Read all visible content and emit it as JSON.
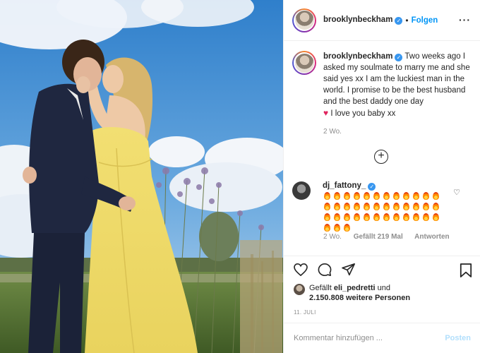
{
  "post": {
    "username": "brooklynbeckham",
    "follow_label": "Folgen",
    "more_icon": "ellipsis-icon",
    "caption": "Two weeks ago I asked my soulmate to marry me and she said yes xx I am the luckiest man in the world. I promise to be the best husband and the best daddy one day",
    "caption_tail": "I love you baby xx",
    "caption_time": "2 Wo.",
    "load_more_icon": "plus-circle-icon"
  },
  "comment": {
    "username": "dj_fattony_",
    "emoji_name": "fire-emoji",
    "emoji_count": 39,
    "time": "2 Wo.",
    "likes": "Gefällt 219 Mal",
    "reply_label": "Antworten"
  },
  "actions": {
    "liked_prefix": "Gefällt",
    "liked_user": "eli_pedretti",
    "liked_and": "und",
    "liked_count": "2.150.808 weitere Personen",
    "date": "11. JULI"
  },
  "comment_box": {
    "placeholder": "Kommentar hinzufügen ...",
    "post_label": "Posten"
  },
  "colors": {
    "accent": "#0095f6",
    "verified": "#3897f0",
    "heart": "#e0245e",
    "dress": "#f3e27a",
    "sky": "#3f8fd6"
  }
}
